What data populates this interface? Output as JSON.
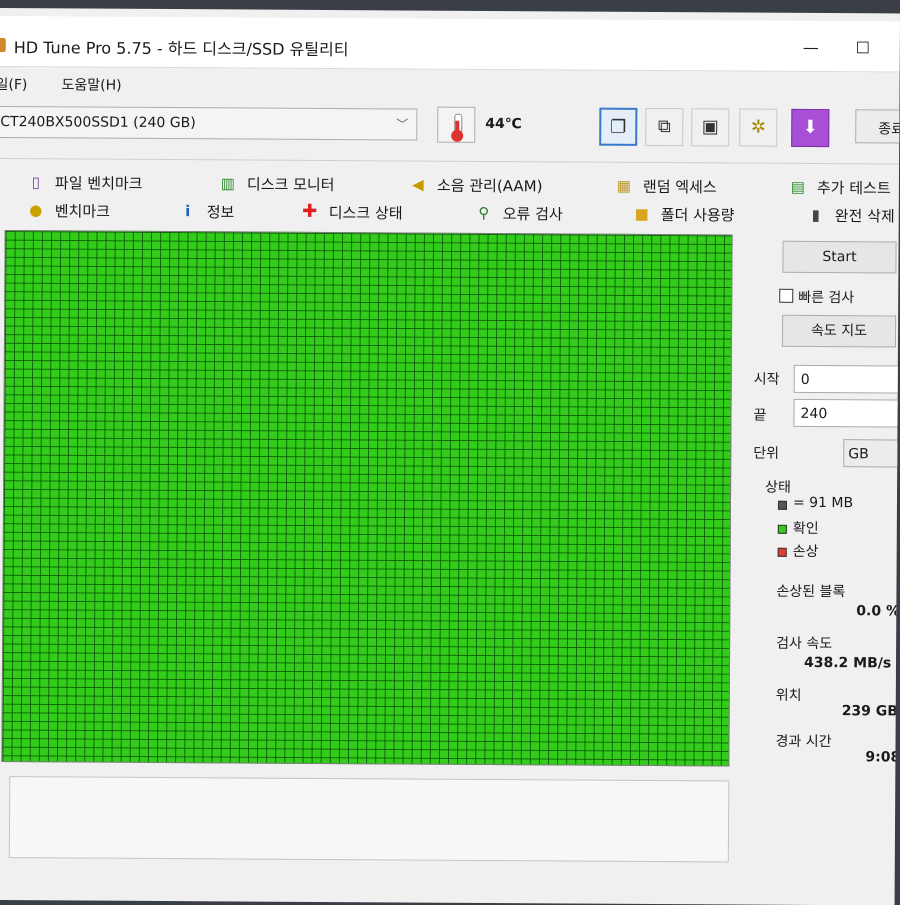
{
  "window": {
    "title": "HD Tune Pro 5.75 - 하드 디스크/SSD 유틸리티",
    "min_glyph": "—",
    "max_glyph": "☐"
  },
  "menu": [
    "일(F)",
    "도움말(H)"
  ],
  "drive": {
    "selected": "CT240BX500SSD1 (240 GB)"
  },
  "temperature": "44℃",
  "toolbar": {
    "icons": [
      "copy-info-icon",
      "copy-screenshot-icon",
      "camera-icon",
      "settings-icon",
      "save-icon"
    ],
    "exit_label": "종료"
  },
  "tabs": {
    "row1": [
      {
        "label": "파일 벤치마크",
        "icon": "file-benchmark-icon"
      },
      {
        "label": "디스크 모니터",
        "icon": "disk-monitor-icon"
      },
      {
        "label": "소음 관리(AAM)",
        "icon": "speaker-icon"
      },
      {
        "label": "랜덤 엑세스",
        "icon": "random-access-icon"
      },
      {
        "label": "추가 테스트",
        "icon": "extra-tests-icon"
      }
    ],
    "row2": [
      {
        "label": "벤치마크",
        "icon": "benchmark-icon"
      },
      {
        "label": "정보",
        "icon": "info-icon"
      },
      {
        "label": "디스크 상태",
        "icon": "health-cross-icon"
      },
      {
        "label": "오류 검사",
        "icon": "magnifier-icon"
      },
      {
        "label": "폴더 사용량",
        "icon": "folder-icon"
      },
      {
        "label": "완전 삭제",
        "icon": "trash-icon"
      }
    ]
  },
  "scan": {
    "start_label": "Start",
    "quick_scan_label": "빠른 검사",
    "quick_scan_checked": false,
    "speed_map_label": "속도 지도",
    "start_field_label": "시작",
    "start_value": "0",
    "end_field_label": "끝",
    "end_value": "240",
    "unit_label": "단위",
    "unit_value": "GB"
  },
  "legend": {
    "title": "상태",
    "block_size": "= 91 MB",
    "ok_label": "확인",
    "damaged_label": "손상",
    "colors": {
      "block": "#555555",
      "ok": "#33cc1a",
      "damaged": "#e03a3a"
    }
  },
  "stats": {
    "damaged_blocks_label": "손상된 블록",
    "damaged_blocks_value": "0.0 %",
    "scan_speed_label": "검사 속도",
    "scan_speed_value": "438.2 MB/s",
    "position_label": "위치",
    "position_value": "239 GB",
    "elapsed_label": "경과 시간",
    "elapsed_value": "9:08"
  },
  "colors": {
    "map_green": "#33cc1a",
    "active_tab_border": "#3a78c9"
  }
}
